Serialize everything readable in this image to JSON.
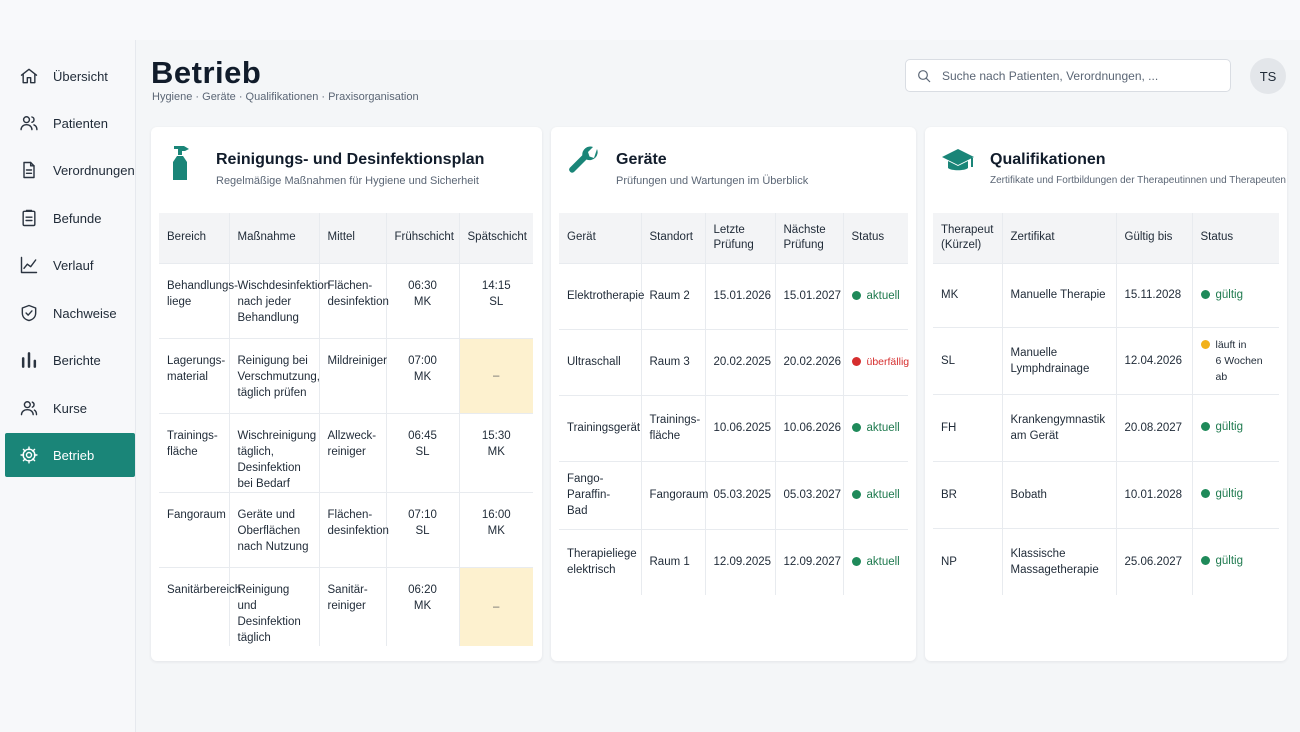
{
  "nav": {
    "items": [
      {
        "label": "Übersicht",
        "icon": "home-icon"
      },
      {
        "label": "Patienten",
        "icon": "users-icon"
      },
      {
        "label": "Verordnungen",
        "icon": "document-icon"
      },
      {
        "label": "Befunde",
        "icon": "clipboard-icon"
      },
      {
        "label": "Verlauf",
        "icon": "chart-line-icon"
      },
      {
        "label": "Nachweise",
        "icon": "shield-check-icon"
      },
      {
        "label": "Berichte",
        "icon": "bar-chart-icon"
      },
      {
        "label": "Kurse",
        "icon": "group-icon"
      },
      {
        "label": "Betrieb",
        "icon": "gear-icon",
        "active": true
      }
    ]
  },
  "header": {
    "title": "Betrieb",
    "subtitle": "Hygiene · Geräte · Qualifikationen · Praxisorganisation",
    "search_placeholder": "Suche nach Patienten, Verordnungen, ...",
    "avatar_initials": "TS"
  },
  "colors": {
    "accent": "#1a8578",
    "ok": "#1f8a5a",
    "overdue": "#d62e2e",
    "warning": "#f2b11a",
    "empty_slot": "#fdf1cf"
  },
  "cleaning": {
    "icon": "spray-bottle-icon",
    "title": "Reinigungs- und Desinfektionsplan",
    "subtitle": "Regelmäßige Maßnahmen für Hygiene und Sicherheit",
    "columns": [
      "Bereich",
      "Maßnahme",
      "Mittel",
      "Frühschicht",
      "Spätschicht"
    ],
    "rows": [
      {
        "bereich": "Behandlungs-\nliege",
        "massnahme": "Wischdesinfektion\nnach jeder\nBehandlung",
        "mittel": "Flächen-\ndesinfektion",
        "frueh": "06:30\nMK",
        "spaet": "14:15\nSL"
      },
      {
        "bereich": "Lagerungs-\nmaterial",
        "massnahme": "Reinigung bei\nVerschmutzung,\ntäglich prüfen",
        "mittel": "Mildreiniger",
        "frueh": "07:00\nMK",
        "spaet": "–"
      },
      {
        "bereich": "Trainings-\nfläche",
        "massnahme": "Wischreinigung\ntäglich, Desinfektion\nbei Bedarf",
        "mittel": "Allzweck-\nreiniger",
        "frueh": "06:45\nSL",
        "spaet": "15:30\nMK"
      },
      {
        "bereich": "Fangoraum",
        "massnahme": "Geräte und\nOberflächen\nnach Nutzung",
        "mittel": "Flächen-\ndesinfektion",
        "frueh": "07:10\nSL",
        "spaet": "16:00\nMK"
      },
      {
        "bereich": "Sanitärbereich",
        "massnahme": "Reinigung und\nDesinfektion\ntäglich",
        "mittel": "Sanitär-\nreiniger",
        "frueh": "06:20\nMK",
        "spaet": "–"
      }
    ]
  },
  "devices": {
    "icon": "wrench-icon",
    "title": "Geräte",
    "subtitle": "Prüfungen und Wartungen im Überblick",
    "columns": [
      "Gerät",
      "Standort",
      "Letzte\nPrüfung",
      "Nächste\nPrüfung",
      "Status"
    ],
    "rows": [
      {
        "geraet": "Elektrotherapie",
        "standort": "Raum 2",
        "letzte": "15.01.2026",
        "naechste": "15.01.2027",
        "status": "aktuell",
        "tone": "green"
      },
      {
        "geraet": "Ultraschall",
        "standort": "Raum 3",
        "letzte": "20.02.2025",
        "naechste": "20.02.2026",
        "status": "überfällig",
        "tone": "red"
      },
      {
        "geraet": "Trainingsgerät",
        "standort": "Trainings-\nfläche",
        "letzte": "10.06.2025",
        "naechste": "10.06.2026",
        "status": "aktuell",
        "tone": "green"
      },
      {
        "geraet": "Fango-Paraffin-\nBad",
        "standort": "Fangoraum",
        "letzte": "05.03.2025",
        "naechste": "05.03.2027",
        "status": "aktuell",
        "tone": "green"
      },
      {
        "geraet": "Therapieliege\nelektrisch",
        "standort": "Raum 1",
        "letzte": "12.09.2025",
        "naechste": "12.09.2027",
        "status": "aktuell",
        "tone": "green"
      }
    ]
  },
  "qualifications": {
    "icon": "graduation-cap-icon",
    "title": "Qualifikationen",
    "subtitle": "Zertifikate und Fortbildungen der Therapeutinnen und Therapeuten",
    "columns": [
      "Therapeut\n(Kürzel)",
      "Zertifikat",
      "Gültig bis",
      "Status"
    ],
    "rows": [
      {
        "kuerzel": "MK",
        "zertifikat": "Manuelle Therapie",
        "gueltig": "15.11.2028",
        "status": "gültig",
        "tone": "green"
      },
      {
        "kuerzel": "SL",
        "zertifikat": "Manuelle\nLymphdrainage",
        "gueltig": "12.04.2026",
        "status": "läuft in\n6 Wochen ab",
        "tone": "amber"
      },
      {
        "kuerzel": "FH",
        "zertifikat": "Krankengymnastik\nam Gerät",
        "gueltig": "20.08.2027",
        "status": "gültig",
        "tone": "green"
      },
      {
        "kuerzel": "BR",
        "zertifikat": "Bobath",
        "gueltig": "10.01.2028",
        "status": "gültig",
        "tone": "green"
      },
      {
        "kuerzel": "NP",
        "zertifikat": "Klassische\nMassagetherapie",
        "gueltig": "25.06.2027",
        "status": "gültig",
        "tone": "green"
      }
    ]
  }
}
